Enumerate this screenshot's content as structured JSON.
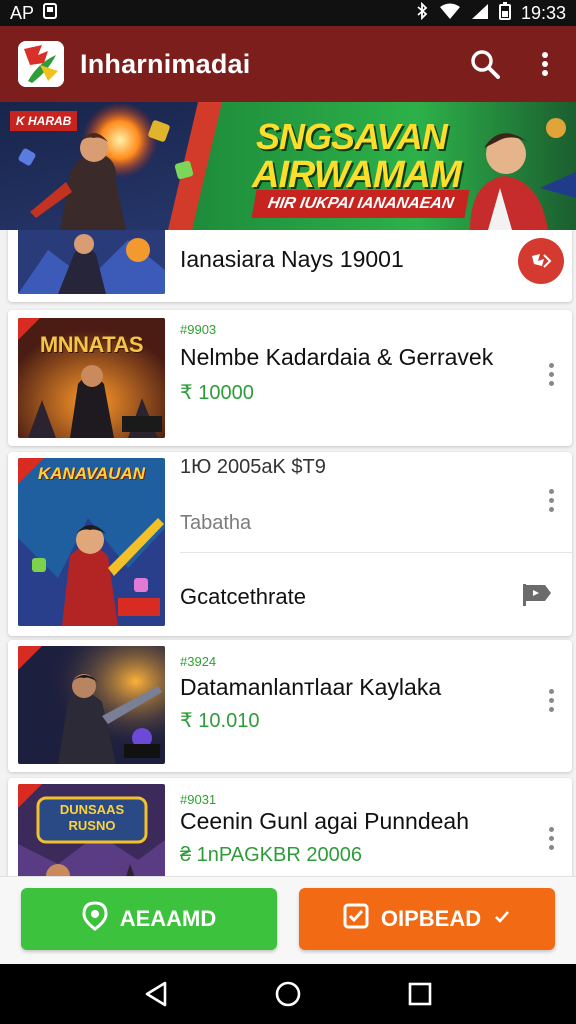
{
  "status_bar": {
    "left_text": "AP",
    "time": "19:33"
  },
  "app_bar": {
    "title": "Inharnimadai"
  },
  "banner": {
    "tag": "K HARAB",
    "headline_line1": "SNGSAVAN",
    "headline_line2": "AIRWAMAM",
    "ribbon": "HIR IUKPAI IANANAEAN"
  },
  "list": {
    "items": [
      {
        "title": "Ianasiara Nays 19001",
        "action_icon": "flag-circle-icon"
      },
      {
        "thumb_label": "MNNATAS",
        "tag": "#9903",
        "title": "Nelmbe Kadardaia & Gerravek",
        "price": "₹ 10000"
      },
      {
        "thumb_label": "KANAVAUAN",
        "title": "1Ю 2005aK $T9",
        "subtitle": "Tabatha",
        "footer_title": "Gcatcethrate",
        "footer_icon": "flag-icon"
      },
      {
        "tag": "#3924",
        "title": "Datamanlanтlaar Kaylaka",
        "price": "₹ 10.010"
      },
      {
        "thumb_label": "DUNSAAS RUSNO",
        "tag": "#9031",
        "title": "Ceenin Gunl agai Punndeah",
        "price": "₴ 1nPAGKBR 20006"
      }
    ]
  },
  "action_bar": {
    "left_label": "AEAAMD",
    "right_label": "OIPBEAD"
  },
  "colors": {
    "app_bar": "#7b1e1c",
    "green_button": "#3cc23c",
    "orange_button": "#f26a14",
    "price_green": "#2e9c3a",
    "accent_red": "#d53a30"
  }
}
